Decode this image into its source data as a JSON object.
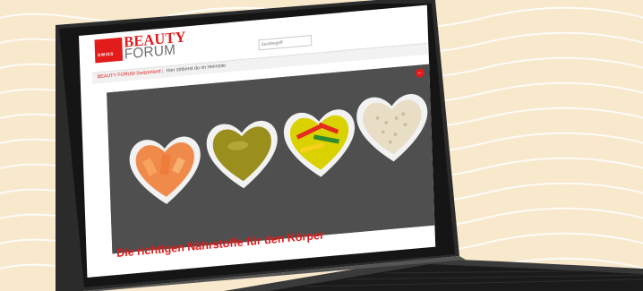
{
  "site": {
    "logo_country": "SWISS",
    "logo_line1": "BEAUTY",
    "logo_line2": "FORUM",
    "search_placeholder": "Suchbegriff",
    "nav_primary": "BEAUTY FORUM Switzerland",
    "nav_separator": "|",
    "nav_secondary": "Hier stöberst du im Heimsite"
  },
  "article": {
    "badge": "←",
    "headline": "Die richtigen Nährstoffe für den Körper"
  },
  "colors": {
    "background": "#f8e8cc",
    "wave": "#ffffff",
    "brand_red": "#e21b1b",
    "laptop_body": "#2b2b2b",
    "keyboard": "#1b1b1b"
  },
  "icons": {
    "hero_badge": "arrow-left-icon"
  }
}
